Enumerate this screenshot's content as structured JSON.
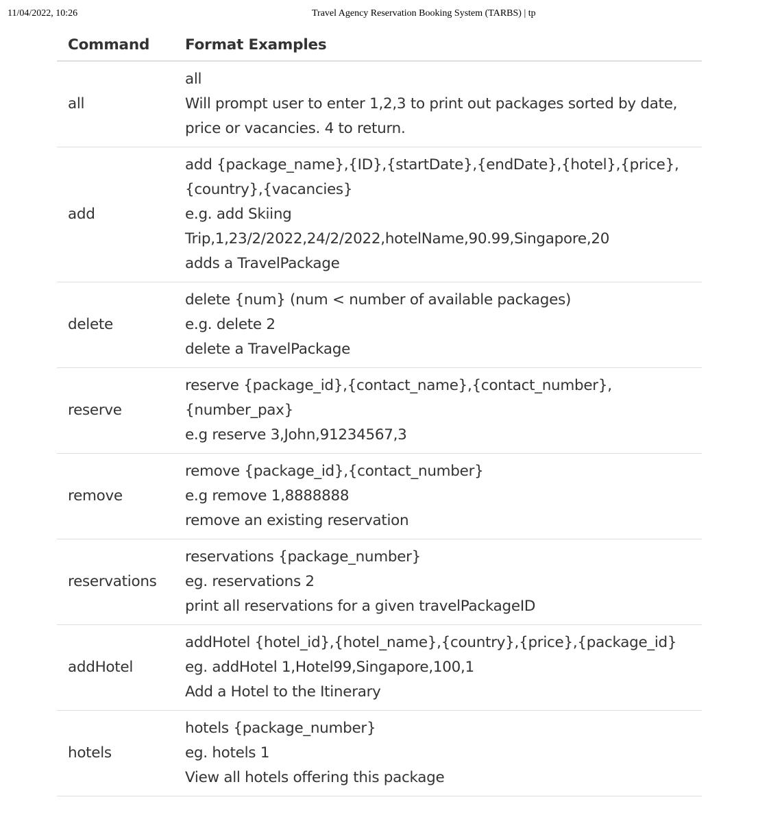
{
  "print_header": {
    "datetime": "11/04/2022, 10:26",
    "title": "Travel Agency Reservation Booking System (TARBS) | tp"
  },
  "table": {
    "headers": [
      "Command",
      "Format Examples"
    ],
    "rows": [
      {
        "command": "all",
        "lines": [
          "all",
          "Will prompt user to enter 1,2,3 to print out packages sorted by date, price or vacancies. 4 to return."
        ]
      },
      {
        "command": "add",
        "lines": [
          "add {package_name},{ID},{startDate},{endDate},{hotel},{price},{country},{vacancies}",
          "e.g. add Skiing Trip,1,23/2/2022,24/2/2022,hotelName,90.99,Singapore,20",
          "adds a TravelPackage"
        ]
      },
      {
        "command": "delete",
        "lines": [
          "delete {num} (num < number of available packages)",
          "e.g. delete 2",
          "delete a TravelPackage"
        ]
      },
      {
        "command": "reserve",
        "lines": [
          "reserve {package_id},{contact_name},{contact_number},{number_pax}",
          "e.g reserve 3,John,91234567,3"
        ]
      },
      {
        "command": "remove",
        "lines": [
          "remove {package_id},{contact_number}",
          "e.g remove 1,8888888",
          "remove an existing reservation"
        ]
      },
      {
        "command": "reservations",
        "lines": [
          "reservations {package_number}",
          "eg. reservations 2",
          "print all reservations for a given travelPackageID"
        ]
      },
      {
        "command": "addHotel",
        "lines": [
          "addHotel {hotel_id},{hotel_name},{country},{price},{package_id}",
          "eg. addHotel 1,Hotel99,Singapore,100,1",
          "Add a Hotel to the Itinerary"
        ]
      },
      {
        "command": "hotels",
        "lines": [
          "hotels {package_number}",
          "eg. hotels 1",
          "View all hotels offering this package"
        ]
      }
    ]
  }
}
